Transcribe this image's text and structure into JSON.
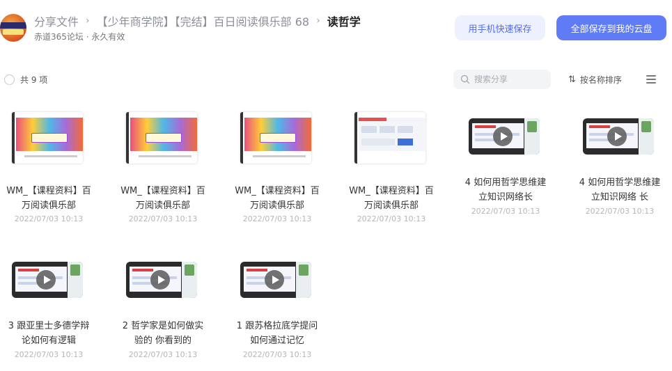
{
  "header": {
    "breadcrumb": [
      {
        "label": "分享文件"
      },
      {
        "label": "【少年商学院】【完结】百日阅读俱乐部 68"
      },
      {
        "label": "读哲学"
      }
    ],
    "subtitle": "赤道365论坛 · 永久有效",
    "btn_mobile_save": "用手机快速保存",
    "btn_save_all": "全部保存到我的云盘"
  },
  "toolbar": {
    "count": "共 9 项",
    "search_placeholder": "搜索分享",
    "sort_label": "按名称排序"
  },
  "files": [
    {
      "name": "WM_【课程资料】百万阅读俱乐部",
      "date": "2022/07/03 10:13",
      "kind": "image"
    },
    {
      "name": "WM_【课程资料】百万阅读俱乐部",
      "date": "2022/07/03 10:13",
      "kind": "image"
    },
    {
      "name": "WM_【课程资料】百万阅读俱乐部",
      "date": "2022/07/03 10:13",
      "kind": "image"
    },
    {
      "name": "WM_【课程资料】百万阅读俱乐部",
      "date": "2022/07/03 10:13",
      "kind": "doc"
    },
    {
      "name": "4 如何用哲学思维建立知识网络长",
      "date": "2022/07/03 10:13",
      "kind": "video"
    },
    {
      "name": "4 如何用哲学思维建立知识网络 长",
      "date": "2022/07/03 10:13",
      "kind": "video"
    },
    {
      "name": "3 跟亚里士多德学辩论如何有逻辑",
      "date": "2022/07/03 10:13",
      "kind": "video"
    },
    {
      "name": "2 哲学家是如何做实验的 你看到的",
      "date": "2022/07/03 10:13",
      "kind": "video"
    },
    {
      "name": "1 跟苏格拉底学提问 如何通过记忆",
      "date": "2022/07/03 10:13",
      "kind": "video"
    }
  ],
  "colors": {
    "accent": "#5f7cf6",
    "accent_light": "#eef0fd"
  }
}
